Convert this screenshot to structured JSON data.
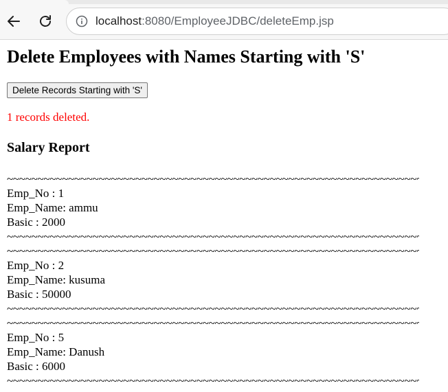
{
  "browser": {
    "url_host": "localhost",
    "url_path": ":8080/EmployeeJDBC/deleteEmp.jsp"
  },
  "page": {
    "title": "Delete Employees with Names Starting with 'S'",
    "delete_button_label": "Delete Records Starting with 'S'",
    "status_message": "1 records deleted.",
    "report_heading": "Salary Report",
    "separator": "~~~~~~~~~~~~~~~~~~~~~~~~~~~~~~~~~~~~~~~~~~~~~~~~~~~~~~~~~~~~~~~~~~~~~~~~~~~~~~~~",
    "employees": [
      {
        "emp_no": "Emp_No : 1",
        "emp_name": "Emp_Name: ammu",
        "basic": "Basic : 2000"
      },
      {
        "emp_no": "Emp_No : 2",
        "emp_name": "Emp_Name: kusuma",
        "basic": "Basic : 50000"
      },
      {
        "emp_no": "Emp_No : 5",
        "emp_name": "Emp_Name: Danush",
        "basic": "Basic : 6000"
      }
    ]
  },
  "colors": {
    "status_message": "#ff0000"
  }
}
